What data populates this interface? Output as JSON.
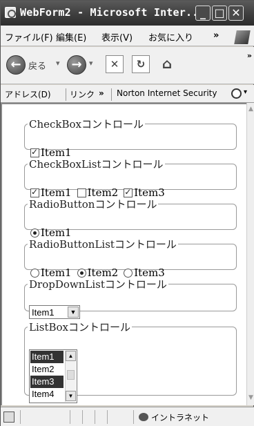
{
  "window": {
    "title": "WebForm2 - Microsoft Inter...",
    "min": "_",
    "max": "□",
    "close": "✕"
  },
  "menu": [
    "ファイル(F)",
    "編集(E)",
    "表示(V)",
    "お気に入り"
  ],
  "menu_more": "»",
  "toolbar": {
    "back": "戻る",
    "dropdown": "▾",
    "more": "»"
  },
  "address_bar": {
    "address": "アドレス(D)",
    "links": "リンク",
    "more": "»",
    "norton": "Norton Internet Security",
    "norton_drop": "▾"
  },
  "groups": {
    "checkbox": {
      "legend": "CheckBoxコントロール",
      "item": {
        "label": "Item1",
        "checked": true
      }
    },
    "checkboxlist": {
      "legend": "CheckBoxListコントロール",
      "items": [
        {
          "label": "Item1",
          "checked": true
        },
        {
          "label": "Item2",
          "checked": false
        },
        {
          "label": "Item3",
          "checked": true
        }
      ]
    },
    "radiobutton": {
      "legend": "RadioButtonコントロール",
      "item": {
        "label": "Item1",
        "checked": true
      }
    },
    "radiobuttonlist": {
      "legend": "RadioButtonListコントロール",
      "items": [
        {
          "label": "Item1",
          "checked": false
        },
        {
          "label": "Item2",
          "checked": true
        },
        {
          "label": "Item3",
          "checked": false
        }
      ]
    },
    "dropdownlist": {
      "legend": "DropDownListコントロール",
      "selected": "Item1"
    },
    "listbox": {
      "legend": "ListBoxコントロール",
      "items": [
        {
          "label": "Item1",
          "selected": true
        },
        {
          "label": "Item2",
          "selected": false
        },
        {
          "label": "Item3",
          "selected": true
        },
        {
          "label": "Item4",
          "selected": false
        }
      ]
    }
  },
  "status": {
    "zone": "イントラネット"
  },
  "colors": {
    "titlebar": "#3c3c3c",
    "selection": "#333333",
    "chrome": "#f0f0f0"
  }
}
